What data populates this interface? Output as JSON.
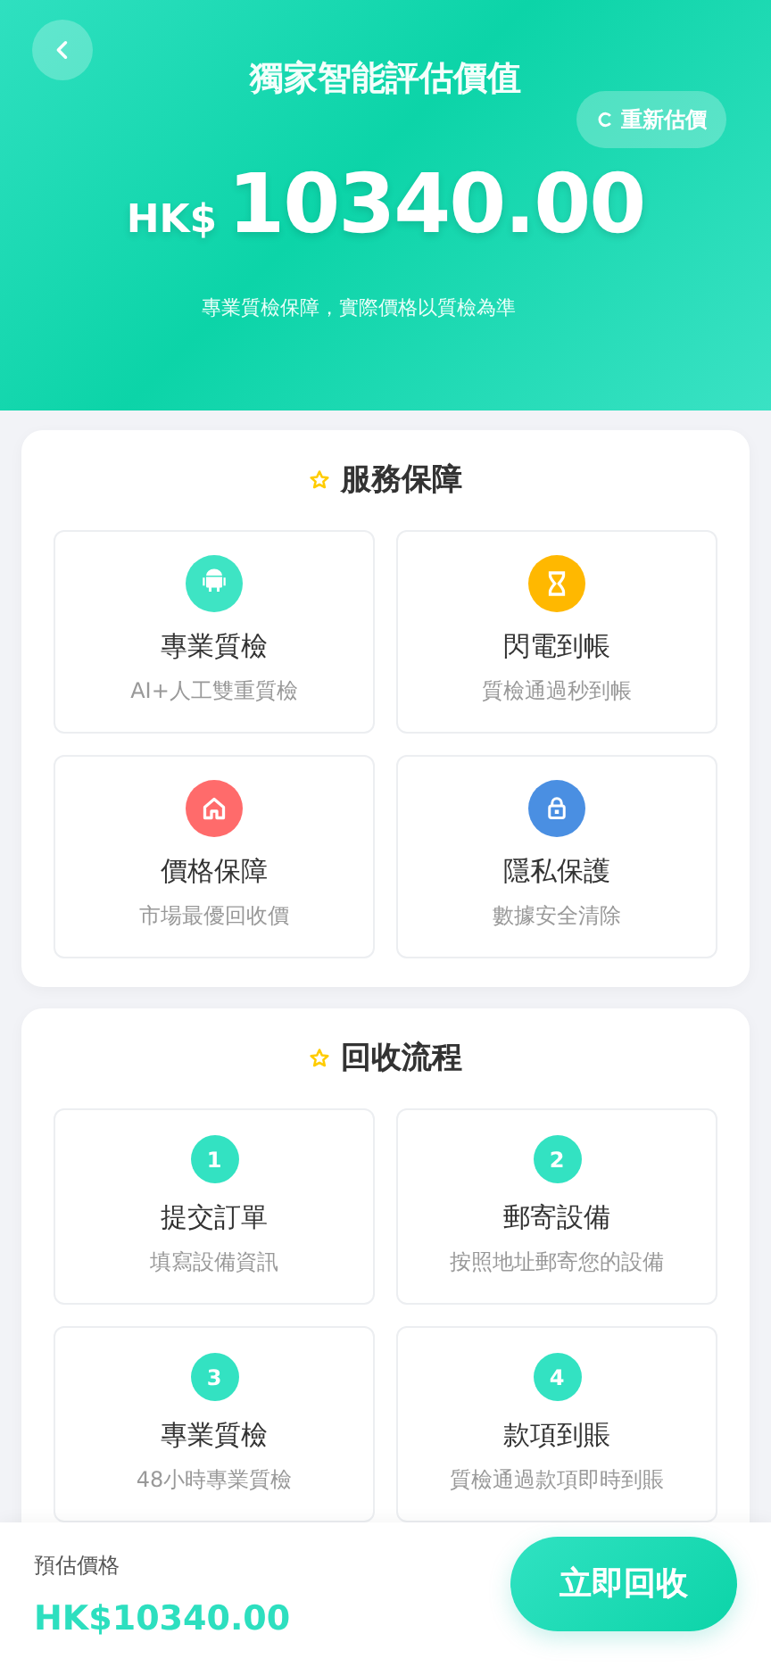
{
  "header": {
    "title": "獨家智能評估價值",
    "refresh_button": "重新估價",
    "currency": "HK$",
    "amount": "10340.00",
    "note": "專業質檢保障，實際價格以質檢為準"
  },
  "sections": [
    {
      "title": "服務保障",
      "kind": "features",
      "items": [
        {
          "color": "#3ee4c4",
          "title": "專業質檢",
          "subtitle": "AI+人工雙重質檢"
        },
        {
          "color": "#ffb800",
          "title": "閃電到帳",
          "subtitle": "質檢通過秒到帳"
        },
        {
          "color": "#ff6b6b",
          "title": "價格保障",
          "subtitle": "市場最優回收價"
        },
        {
          "color": "#4a8fe2",
          "title": "隱私保護",
          "subtitle": "數據安全清除"
        }
      ]
    },
    {
      "title": "回收流程",
      "kind": "steps",
      "items": [
        {
          "number": "1",
          "title": "提交訂單",
          "subtitle": "填寫設備資訊"
        },
        {
          "number": "2",
          "title": "郵寄設備",
          "subtitle": "按照地址郵寄您的設備"
        },
        {
          "number": "3",
          "title": "專業質檢",
          "subtitle": "48小時專業質檢"
        },
        {
          "number": "4",
          "title": "款項到賬",
          "subtitle": "質檢通過款項即時到賬"
        }
      ]
    }
  ],
  "bottom_bar": {
    "label": "預估價格",
    "price": "HK$10340.00",
    "button": "立即回收"
  }
}
